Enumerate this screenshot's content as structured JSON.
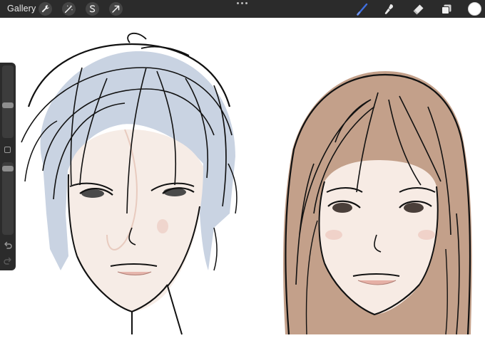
{
  "toolbar": {
    "gallery_label": "Gallery",
    "left_tools": [
      "wrench-icon",
      "magic-wand-icon",
      "selection-s-icon",
      "transform-arrow-icon"
    ],
    "right_tools": [
      "brush-icon",
      "smudge-icon",
      "eraser-icon",
      "layers-icon"
    ],
    "active_tool": "brush-icon",
    "brush_color": "#3f6fe0",
    "current_color": "#ffffff"
  },
  "sidebar": {
    "size_slider_level": 0.55,
    "opacity_slider_level": 0.05
  },
  "canvas": {
    "content": "illustration-two-faces"
  }
}
